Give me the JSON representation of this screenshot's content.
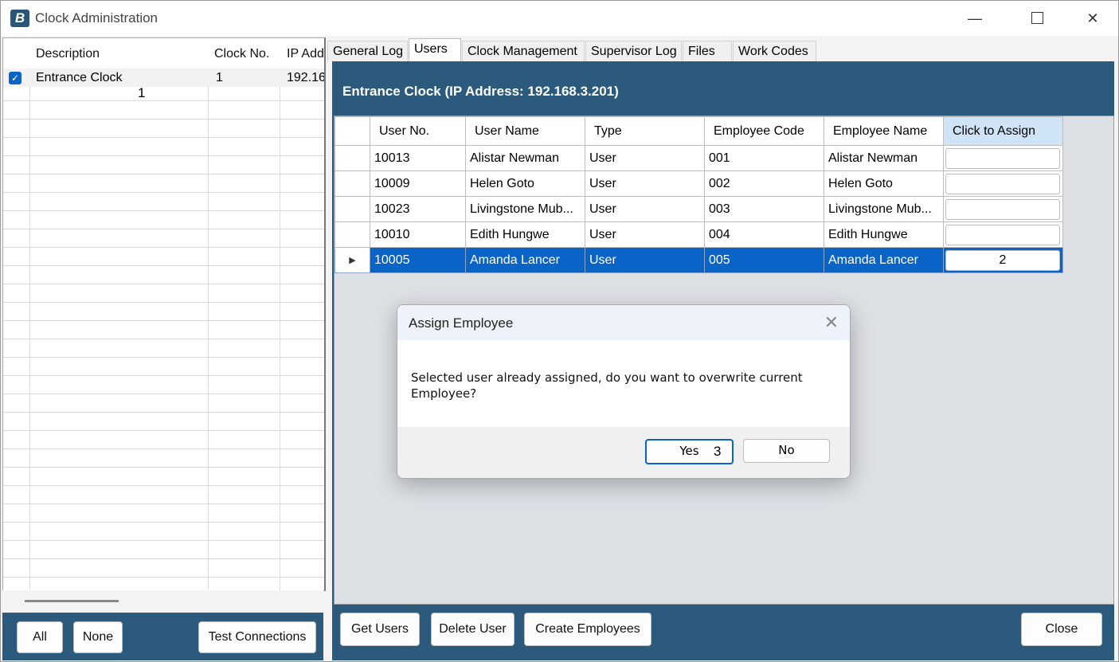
{
  "window": {
    "title": "Clock Administration",
    "app_icon_glyph": "B"
  },
  "icons": {
    "minimize": "minimize-icon",
    "maximize": "maximize-icon",
    "close": "close-icon",
    "check": "checkmark-icon",
    "row_pointer": "row-pointer-icon"
  },
  "left_grid": {
    "headers": [
      "Description",
      "Clock No.",
      "IP Add"
    ],
    "rows": [
      {
        "checked": true,
        "description": "Entrance Clock",
        "clock_no": "1",
        "ip": "192.16"
      }
    ],
    "buttons": {
      "all": "All",
      "none": "None",
      "test": "Test Connections"
    }
  },
  "tabs": [
    "General Log",
    "Users",
    "Clock Management",
    "Supervisor Log",
    "Files",
    "Work Codes"
  ],
  "active_tab": "Users",
  "panel_title": "Entrance Clock (IP Address: 192.168.3.201)",
  "users_grid": {
    "headers": [
      "User No.",
      "User Name",
      "Type",
      "Employee Code",
      "Employee Name",
      "Click to Assign"
    ],
    "rows": [
      {
        "user_no": "10013",
        "user_name": "Alistar Newman",
        "type": "User",
        "emp_code": "001",
        "emp_name": "Alistar  Newman",
        "assign": ""
      },
      {
        "user_no": "10009",
        "user_name": "Helen Goto",
        "type": "User",
        "emp_code": "002",
        "emp_name": "Helen  Goto",
        "assign": ""
      },
      {
        "user_no": "10023",
        "user_name": "Livingstone Mub...",
        "type": "User",
        "emp_code": "003",
        "emp_name": "Livingstone  Mub...",
        "assign": ""
      },
      {
        "user_no": "10010",
        "user_name": "Edith Hungwe",
        "type": "User",
        "emp_code": "004",
        "emp_name": "Edith  Hungwe",
        "assign": ""
      },
      {
        "user_no": "10005",
        "user_name": "Amanda Lancer",
        "type": "User",
        "emp_code": "005",
        "emp_name": "Amanda  Lancer",
        "assign": "2",
        "selected": true
      }
    ]
  },
  "bottom_buttons": {
    "get_users": "Get Users",
    "delete_user": "Delete User",
    "create_employees": "Create Employees",
    "close": "Close"
  },
  "annotations": {
    "step1": "1",
    "step3": "3"
  },
  "dialog": {
    "title": "Assign Employee",
    "message": "Selected user already assigned, do you want to overwrite current Employee?",
    "yes": "Yes",
    "no": "No"
  },
  "colors": {
    "panel_blue": "#2b5a7c",
    "selection_blue": "#0a64c8",
    "assign_header": "#cfe4f7"
  }
}
